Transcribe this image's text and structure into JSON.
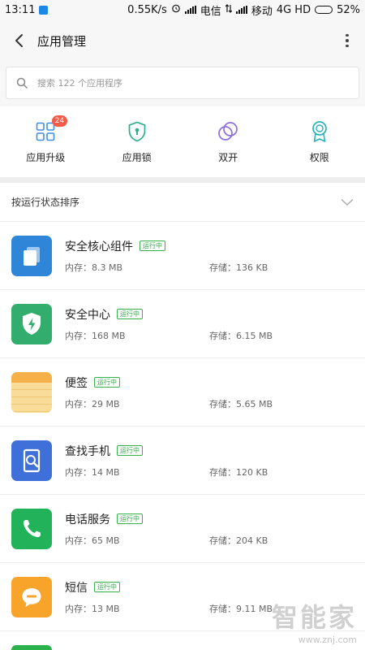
{
  "status_bar": {
    "time": "13:11",
    "speed": "0.55K/s",
    "carrier1": "电信",
    "carrier2": "移动",
    "network": "4G HD",
    "battery": "52%",
    "battery_level": 0.52
  },
  "header": {
    "title": "应用管理"
  },
  "search": {
    "placeholder": "搜索 122 个应用程序"
  },
  "quick_actions": [
    {
      "label": "应用升级",
      "icon": "upgrade-grid-icon",
      "badge": "24"
    },
    {
      "label": "应用锁",
      "icon": "shield-lock-icon"
    },
    {
      "label": "双开",
      "icon": "dual-circle-icon"
    },
    {
      "label": "权限",
      "icon": "ribbon-icon"
    }
  ],
  "sort": {
    "label": "按运行状态排序"
  },
  "apps": [
    {
      "name": "安全核心组件",
      "status": "运行中",
      "memory": "内存：8.3 MB",
      "storage": "存储：136 KB",
      "color": "#2f86d8",
      "icon": "security-core-icon"
    },
    {
      "name": "安全中心",
      "status": "运行中",
      "memory": "内存：168 MB",
      "storage": "存储：6.15 MB",
      "color": "#33ad6d",
      "icon": "security-center-icon"
    },
    {
      "name": "便签",
      "status": "运行中",
      "memory": "内存：29 MB",
      "storage": "存储：5.65 MB",
      "color": "#f5c56a",
      "icon": "notes-icon"
    },
    {
      "name": "查找手机",
      "status": "运行中",
      "memory": "内存：14 MB",
      "storage": "存储：120 KB",
      "color": "#3f6fd8",
      "icon": "find-phone-icon"
    },
    {
      "name": "电话服务",
      "status": "运行中",
      "memory": "内存：65 MB",
      "storage": "存储：204 KB",
      "color": "#22b35a",
      "icon": "phone-icon"
    },
    {
      "name": "短信",
      "status": "运行中",
      "memory": "内存：13 MB",
      "storage": "存储：9.11 MB",
      "color": "#f8a42b",
      "icon": "messaging-icon"
    }
  ],
  "watermark": {
    "brand": "智能家",
    "url": "www.znj.com"
  }
}
